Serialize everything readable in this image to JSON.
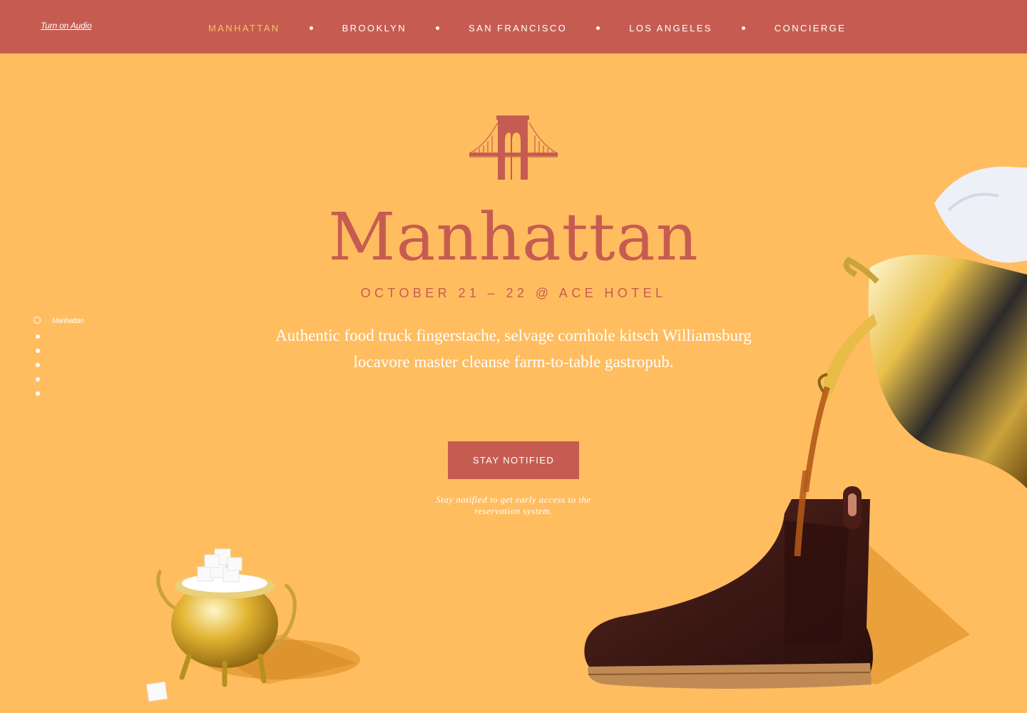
{
  "header": {
    "audio_label": "Turn on Audio",
    "nav": [
      "MANHATTAN",
      "BROOKLYN",
      "SAN FRANCISCO",
      "LOS ANGELES",
      "CONCIERGE"
    ],
    "active": "MANHATTAN"
  },
  "hero": {
    "title": "Manhattan",
    "subtitle": "OCTOBER 21 – 22 @ ACE HOTEL",
    "description": "Authentic food truck fingerstache, selvage cornhole kitsch Williamsburg locavore master cleanse farm-to-table gastropub.",
    "cta": "STAY NOTIFIED",
    "note": "Stay notified to get early access to the reservation system."
  },
  "side_nav": {
    "current": "Manhattan"
  },
  "colors": {
    "background": "#ffbd5f",
    "accent": "#c65c51",
    "text_light": "#ffffff"
  },
  "icons": {
    "logo": "bridge-icon"
  }
}
